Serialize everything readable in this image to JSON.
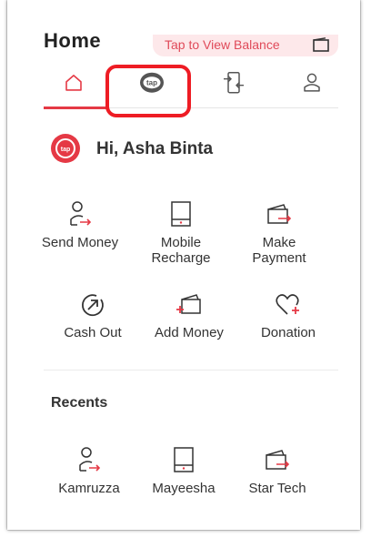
{
  "header": {
    "title": "Home",
    "balance_label": "Tap to View Balance"
  },
  "tabs": [
    {
      "name": "home",
      "icon": "home-icon",
      "active": true
    },
    {
      "name": "tap",
      "icon": "tap-logo-icon",
      "active": false
    },
    {
      "name": "transfer",
      "icon": "phone-transfer-icon",
      "active": false
    },
    {
      "name": "profile",
      "icon": "profile-icon",
      "active": false
    }
  ],
  "greeting": {
    "text": "Hi, Asha Binta",
    "avatar_text": "tap"
  },
  "actions": [
    {
      "label_line1": "Send Money",
      "label_line2": "",
      "icon": "send-money-icon"
    },
    {
      "label_line1": "Mobile",
      "label_line2": "Recharge",
      "icon": "mobile-recharge-icon"
    },
    {
      "label_line1": "Make",
      "label_line2": "Payment",
      "icon": "make-payment-icon"
    },
    {
      "label_line1": "Cash Out",
      "label_line2": "",
      "icon": "cash-out-icon"
    },
    {
      "label_line1": "Add Money",
      "label_line2": "",
      "icon": "add-money-icon"
    },
    {
      "label_line1": "Donation",
      "label_line2": "",
      "icon": "donation-icon"
    }
  ],
  "recents": {
    "title": "Recents",
    "items": [
      {
        "label": "Kamruzza",
        "icon": "send-money-icon"
      },
      {
        "label": "Mayeesha",
        "icon": "mobile-recharge-icon"
      },
      {
        "label": "Star Tech",
        "icon": "make-payment-icon"
      }
    ]
  },
  "colors": {
    "accent": "#e53945",
    "highlight": "#ee1c24",
    "pill_bg": "#fde8ea",
    "text": "#333333"
  }
}
